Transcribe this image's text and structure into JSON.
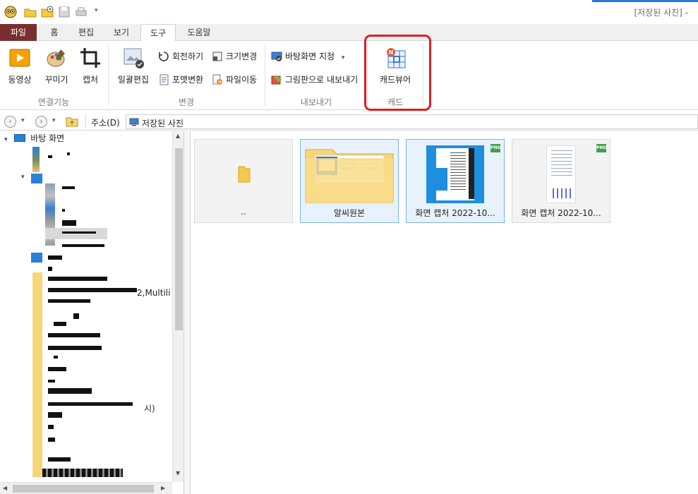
{
  "title": "[저장된 사진] -",
  "tabs": {
    "file": "파일",
    "home": "홈",
    "edit": "편집",
    "view": "보기",
    "tools": "도구",
    "help": "도움말"
  },
  "ribbon": {
    "video": "동영상",
    "decorate": "꾸미기",
    "capture": "캡처",
    "group_connect": "연결기능",
    "batch_edit": "일괄편집",
    "rotate": "회전하기",
    "resize": "크기변경",
    "format_convert": "포맷변환",
    "file_move": "파일이동",
    "group_change": "변경",
    "set_wallpaper": "바탕화면 지정",
    "export_paint": "그림판으로 내보내기",
    "group_export": "내보내기",
    "cad_viewer": "캐드뷰어",
    "group_cad": "캐드"
  },
  "address": {
    "label": "주소(D)",
    "path": "저장된 사진"
  },
  "tree": {
    "root": "바탕 화면",
    "fragment_multi": "2,Multili",
    "fragment_display": "시)"
  },
  "files": [
    {
      "name": ".."
    },
    {
      "name": "알씨원본"
    },
    {
      "name": "화면 캡처 2022-10...",
      "badge": "PNG"
    },
    {
      "name": "화면 캡처 2022-10...",
      "badge": "PNG"
    }
  ],
  "colors": {
    "file_tab": "#7a2f2f",
    "highlight": "#dd1f24",
    "selection_border": "#7bb4e8",
    "folder": "#f7d67a"
  }
}
